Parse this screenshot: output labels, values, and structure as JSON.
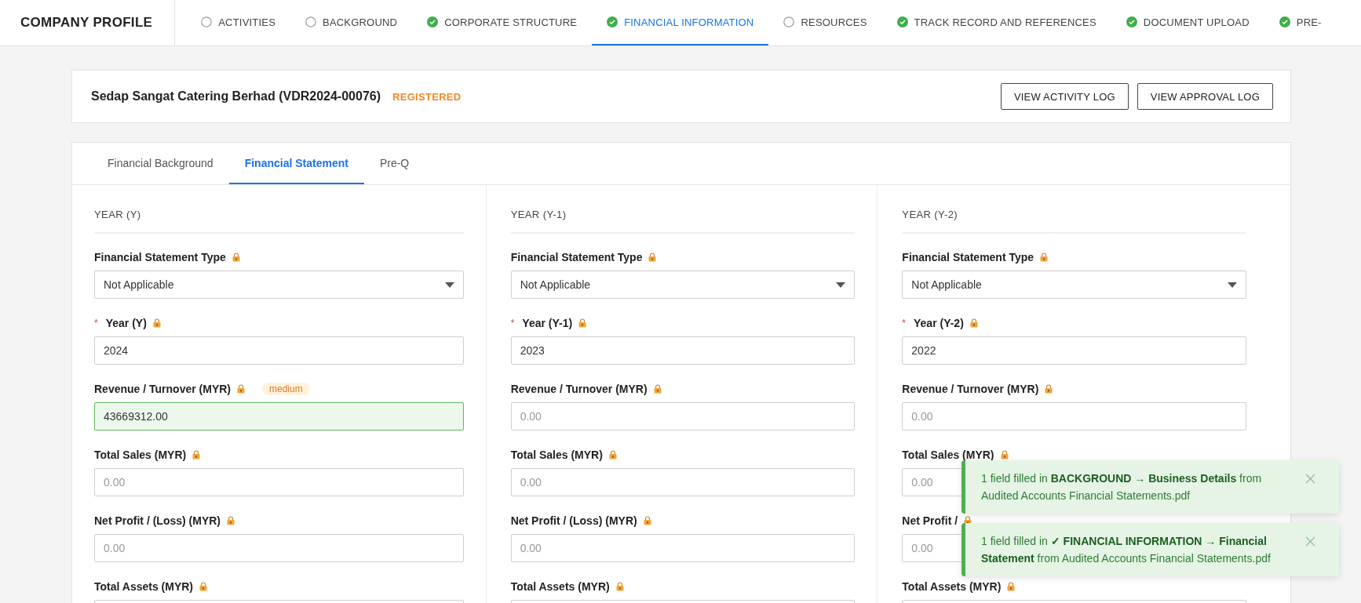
{
  "brand": "COMPANY PROFILE",
  "nav": [
    {
      "label": "ACTIVITIES",
      "complete": false,
      "selected": false
    },
    {
      "label": "BACKGROUND",
      "complete": false,
      "selected": false
    },
    {
      "label": "CORPORATE STRUCTURE",
      "complete": true,
      "selected": false
    },
    {
      "label": "FINANCIAL INFORMATION",
      "complete": true,
      "selected": true
    },
    {
      "label": "RESOURCES",
      "complete": false,
      "selected": false
    },
    {
      "label": "TRACK RECORD AND REFERENCES",
      "complete": true,
      "selected": false
    },
    {
      "label": "DOCUMENT UPLOAD",
      "complete": true,
      "selected": false
    },
    {
      "label": "PRE-",
      "complete": true,
      "selected": false
    }
  ],
  "header": {
    "company": "Sedap Sangat Catering Berhad (VDR2024-00076)",
    "status": "REGISTERED",
    "buttons": [
      "VIEW ACTIVITY LOG",
      "VIEW APPROVAL LOG"
    ]
  },
  "tabs": [
    {
      "label": "Financial Background",
      "selected": false
    },
    {
      "label": "Financial Statement",
      "selected": true
    },
    {
      "label": "Pre-Q",
      "selected": false
    }
  ],
  "columns": [
    {
      "title": "YEAR (Y)",
      "fields": [
        {
          "kind": "select",
          "label": "Financial Statement Type",
          "value": "Not Applicable"
        },
        {
          "kind": "input",
          "label": "Year (Y)",
          "marker": "*",
          "value": "2024"
        },
        {
          "kind": "input",
          "label": "Revenue / Turnover (MYR)",
          "value": "43669312.00",
          "badge": "medium",
          "highlighted": true
        },
        {
          "kind": "input",
          "label": "Total Sales (MYR)",
          "placeholder": "0.00"
        },
        {
          "kind": "input",
          "label": "Net Profit / (Loss) (MYR)",
          "placeholder": "0.00"
        },
        {
          "kind": "input",
          "label": "Total Assets (MYR)"
        }
      ]
    },
    {
      "title": "YEAR (Y-1)",
      "fields": [
        {
          "kind": "select",
          "label": "Financial Statement Type",
          "value": "Not Applicable"
        },
        {
          "kind": "input",
          "label": "Year (Y-1)",
          "marker": "*",
          "value": "2023"
        },
        {
          "kind": "input",
          "label": "Revenue / Turnover (MYR)",
          "placeholder": "0.00"
        },
        {
          "kind": "input",
          "label": "Total Sales (MYR)",
          "placeholder": "0.00"
        },
        {
          "kind": "input",
          "label": "Net Profit / (Loss) (MYR)",
          "placeholder": "0.00"
        },
        {
          "kind": "input",
          "label": "Total Assets (MYR)"
        }
      ]
    },
    {
      "title": "YEAR (Y-2)",
      "fields": [
        {
          "kind": "select",
          "label": "Financial Statement Type",
          "value": "Not Applicable"
        },
        {
          "kind": "input",
          "label": "Year (Y-2)",
          "marker": "*",
          "value": "2022"
        },
        {
          "kind": "input",
          "label": "Revenue / Turnover (MYR)",
          "placeholder": "0.00"
        },
        {
          "kind": "input",
          "label": "Total Sales (MYR)",
          "placeholder": "0.00"
        },
        {
          "kind": "input",
          "label": "Net Profit /",
          "placeholder": "0.00"
        },
        {
          "kind": "input",
          "label": "Total Assets (MYR)"
        }
      ]
    }
  ],
  "toasts": [
    {
      "text": "1 field filled in **BACKGROUND → Business Details** from Audited Accounts Financial Statements.pdf"
    },
    {
      "text": "1 field filled in **✓ FINANCIAL INFORMATION → Financial Statement** from Audited Accounts Financial Statements.pdf"
    }
  ]
}
